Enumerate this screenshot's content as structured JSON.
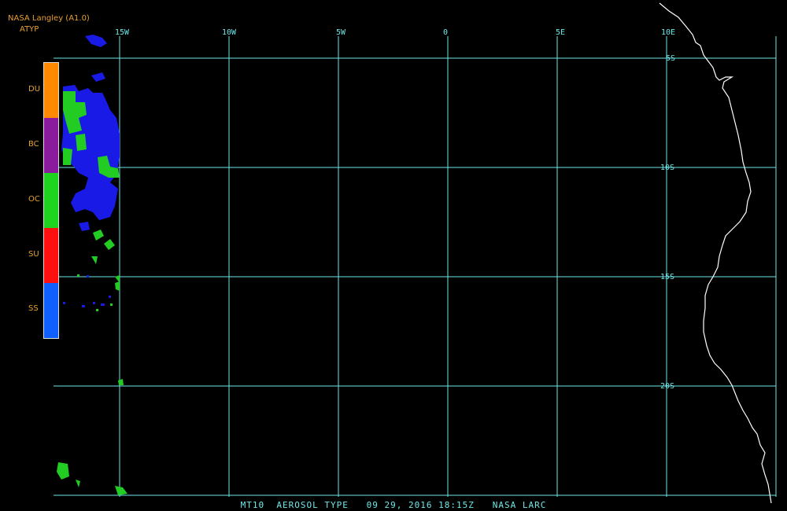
{
  "header": {
    "source": "NASA Langley (A1.0)",
    "product": "ATYP"
  },
  "legend": {
    "classes": [
      {
        "code": "DU",
        "color": "#ff8a00"
      },
      {
        "code": "BC",
        "color": "#8a1b9c"
      },
      {
        "code": "OC",
        "color": "#1fd41f"
      },
      {
        "code": "SU",
        "color": "#ff1010"
      },
      {
        "code": "SS",
        "color": "#1060ff"
      }
    ]
  },
  "grid": {
    "line_color": "#6fe6e6",
    "longitude_labels": [
      "15W",
      "10W",
      "5W",
      "0",
      "5E",
      "10E"
    ],
    "latitude_labels": [
      "5S",
      "10S",
      "15S",
      "20S"
    ]
  },
  "caption": "MT10  AEROSOL TYPE   09 29, 2016 18:15Z   NASA LARC",
  "colors": {
    "background": "#000000",
    "coastline": "#ffffff",
    "aerosol_blue": "#1a1ae6",
    "aerosol_green": "#22cc22"
  }
}
